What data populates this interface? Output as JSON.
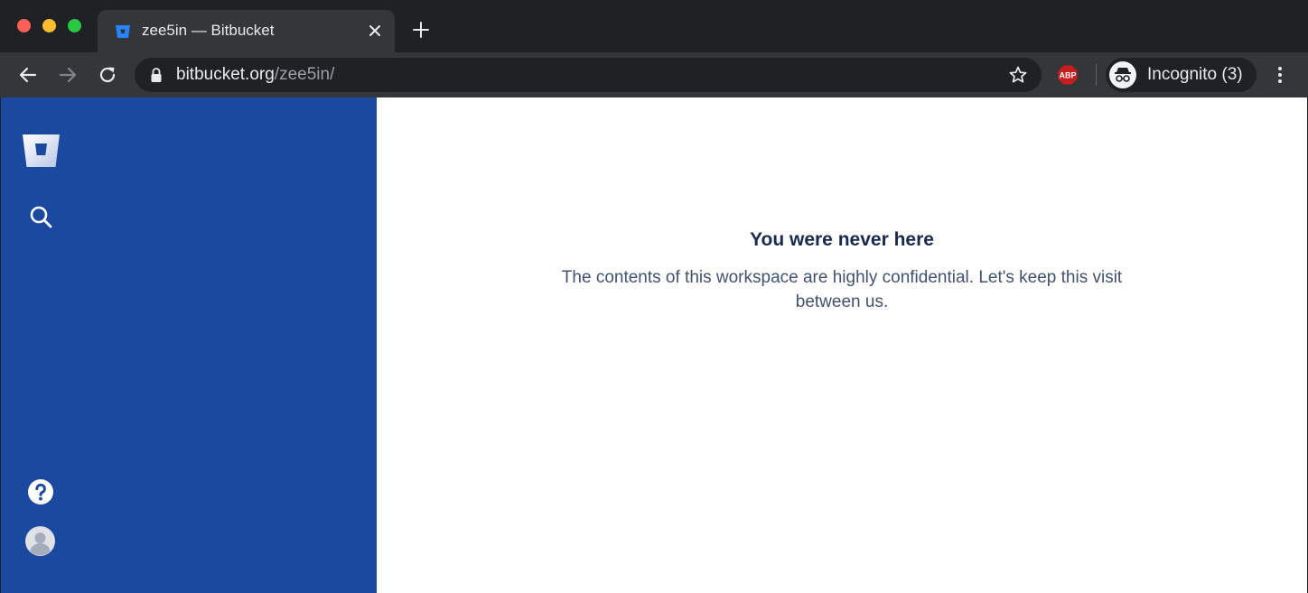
{
  "browser": {
    "tab": {
      "title": "zee5in — Bitbucket",
      "favicon": "bitbucket-icon"
    },
    "address_bar": {
      "domain": "bitbucket.org",
      "path": "/zee5in/"
    },
    "extensions": {
      "abp_label": "ABP"
    },
    "profile": {
      "label": "Incognito (3)",
      "icon": "incognito-icon"
    },
    "colors": {
      "tab_strip": "#202124",
      "toolbar": "#35363a"
    }
  },
  "sidebar": {
    "background": "#1c49a0",
    "icons": [
      "bitbucket-logo-icon",
      "search-icon",
      "help-icon",
      "avatar-icon"
    ]
  },
  "main": {
    "heading": "You were never here",
    "message": "The contents of this workspace are highly confidential. Let's keep this visit between us."
  }
}
